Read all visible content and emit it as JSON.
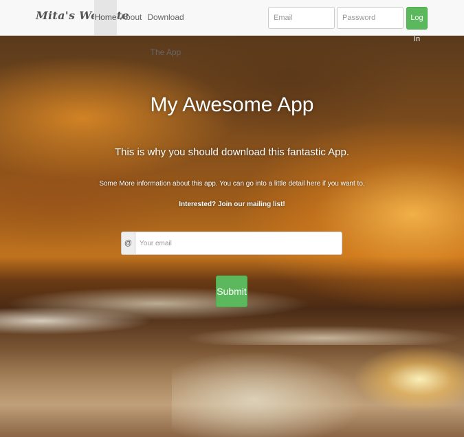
{
  "navbar": {
    "brand": "Mita's Website",
    "items": [
      {
        "label": "Home",
        "active": true
      },
      {
        "label": "About"
      },
      {
        "label": "Download The App"
      }
    ],
    "login": {
      "email_placeholder": "Email",
      "password_placeholder": "Password",
      "button_label": "Log In"
    }
  },
  "hero": {
    "title": "My Awesome App",
    "subtitle": "This is why you should download this fantastic App.",
    "info": "Some More information about this app. You can go into a little detail here if you want to.",
    "cta": "Interested? Join our mailing list!",
    "signup": {
      "addon": "@",
      "placeholder": "Your email",
      "submit_label": "Submit"
    }
  },
  "colors": {
    "accent_green": "#5cb85c",
    "navbar_bg": "#f8f8f8"
  }
}
